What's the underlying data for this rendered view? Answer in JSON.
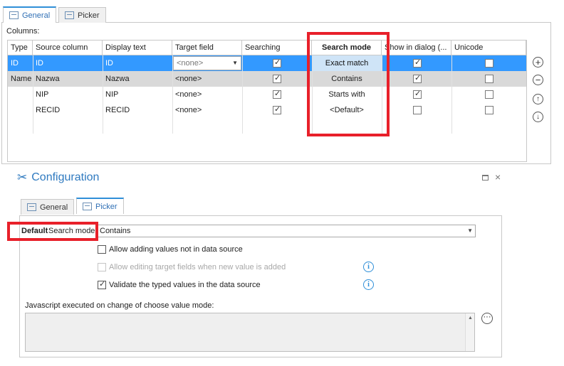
{
  "top": {
    "tabs": [
      {
        "label": "General"
      },
      {
        "label": "Picker"
      }
    ],
    "columns_label": "Columns:",
    "headers": [
      "Type",
      "Source column",
      "Display text",
      "Target field",
      "Searching",
      "Search mode",
      "Show in dialog (...",
      "Unicode"
    ],
    "rows": [
      {
        "type": "ID",
        "source": "ID",
        "display": "ID",
        "target": "<none>",
        "searching": true,
        "mode": "Exact match",
        "show": true,
        "unicode": false
      },
      {
        "type": "Name",
        "source": "Nazwa",
        "display": "Nazwa",
        "target": "<none>",
        "searching": true,
        "mode": "Contains",
        "show": true,
        "unicode": false
      },
      {
        "type": "",
        "source": "NIP",
        "display": "NIP",
        "target": "<none>",
        "searching": true,
        "mode": "Starts with",
        "show": true,
        "unicode": false
      },
      {
        "type": "",
        "source": "RECID",
        "display": "RECID",
        "target": "<none>",
        "searching": true,
        "mode": "<Default>",
        "show": false,
        "unicode": false
      }
    ]
  },
  "config": {
    "title": "Configuration",
    "tabs": [
      {
        "label": "General"
      },
      {
        "label": "Picker"
      }
    ],
    "default_label": "Default",
    "search_mode_label": "Search mode:",
    "search_mode_value": "Contains",
    "options": [
      {
        "label": "Allow adding values not in data source",
        "checked": false,
        "disabled": false
      },
      {
        "label": "Allow editing target fields when new value is added",
        "checked": false,
        "disabled": true
      },
      {
        "label": "Validate the typed values in the data source",
        "checked": true,
        "disabled": false
      }
    ],
    "js_label": "Javascript executed on change of choose value mode:"
  },
  "colors": {
    "accent": "#2f7ac0",
    "selection": "#3399ff",
    "highlight": "#e8202a"
  }
}
